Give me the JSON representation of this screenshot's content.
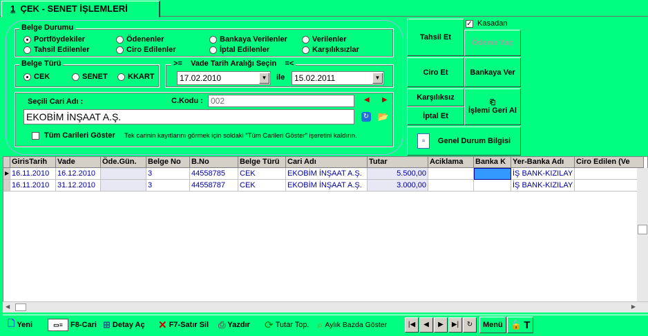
{
  "tab": {
    "number": "1",
    "label": "ÇEK - SENET İŞLEMLERİ"
  },
  "belge_durumu": {
    "title": "Belge Durumu",
    "options": [
      "Portföydekiler",
      "Ödenenler",
      "Bankaya Verilenler",
      "Verilenler",
      "Tahsil Edilenler",
      "Ciro Edilenler",
      "İptal Edilenler",
      "Karşılıksızlar"
    ],
    "selected": "Portföydekiler"
  },
  "belge_turu": {
    "title": "Belge Türü",
    "options": [
      "CEK",
      "SENET",
      "KKART"
    ],
    "selected": "CEK"
  },
  "vade": {
    "title": ">=    Vade Tarih Aralığı Seçin    =<",
    "start": "17.02.2010",
    "connector": "ile",
    "end": "15.02.2011"
  },
  "cari": {
    "label": "Seçili Cari Adı :",
    "kod_label": "C.Kodu :",
    "kod_value": "002",
    "name_value": "EKOBİM İNŞAAT A.Ş.",
    "show_all_label": "Tüm Carileri Göster",
    "hint": "Tek carinin kayıtlarını görmek için soldaki \"Tüm Carileri Göster\" işeretini kaldırın."
  },
  "actions": {
    "tahsil": "Tahsil Et",
    "kasadan": "Kasadan",
    "kasadan_checked": true,
    "odeme": "Ödeme Yap",
    "ciro": "Ciro Et",
    "bankaya": "Bankaya Ver",
    "karsiliksiz": "Karşılıksız",
    "iptal": "İptal Et",
    "geri_al": "İşlemi Geri Al",
    "genel_durum": "Genel Durum Bilgisi"
  },
  "table": {
    "columns": [
      "GirisTarih",
      "Vade",
      "Öde.Gün.",
      "Belge No",
      "B.No",
      "Belge Türü",
      "Cari Adı",
      "Tutar",
      "Aciklama",
      "Banka K",
      "Yer-Banka Adı",
      "Ciro Edilen (Ve"
    ],
    "rows": [
      [
        "16.11.2010",
        "16.12.2010",
        "",
        "3",
        "44558785",
        "CEK",
        "EKOBİM İNŞAAT A.Ş.",
        "5.500,00",
        "",
        "",
        "İŞ BANK-KIZILAY",
        ""
      ],
      [
        "16.11.2010",
        "31.12.2010",
        "",
        "3",
        "44558787",
        "CEK",
        "EKOBİM İNŞAAT A.Ş.",
        "3.000,00",
        "",
        "",
        "İŞ BANK-KIZILAY",
        ""
      ]
    ]
  },
  "toolbar": {
    "yeni": "Yeni",
    "cari": "F8-Cari",
    "detay": "Detay Aç",
    "sil": "F7-Satır Sil",
    "yazdir": "Yazdır",
    "tutar": "Tutar Top.",
    "aylik": "Aylık Bazda Göster",
    "menu": "Menü",
    "t": "T"
  },
  "colors": {
    "background": "#00ff80",
    "grid_text": "#0000a0",
    "selected_cell": "#3399ff"
  }
}
